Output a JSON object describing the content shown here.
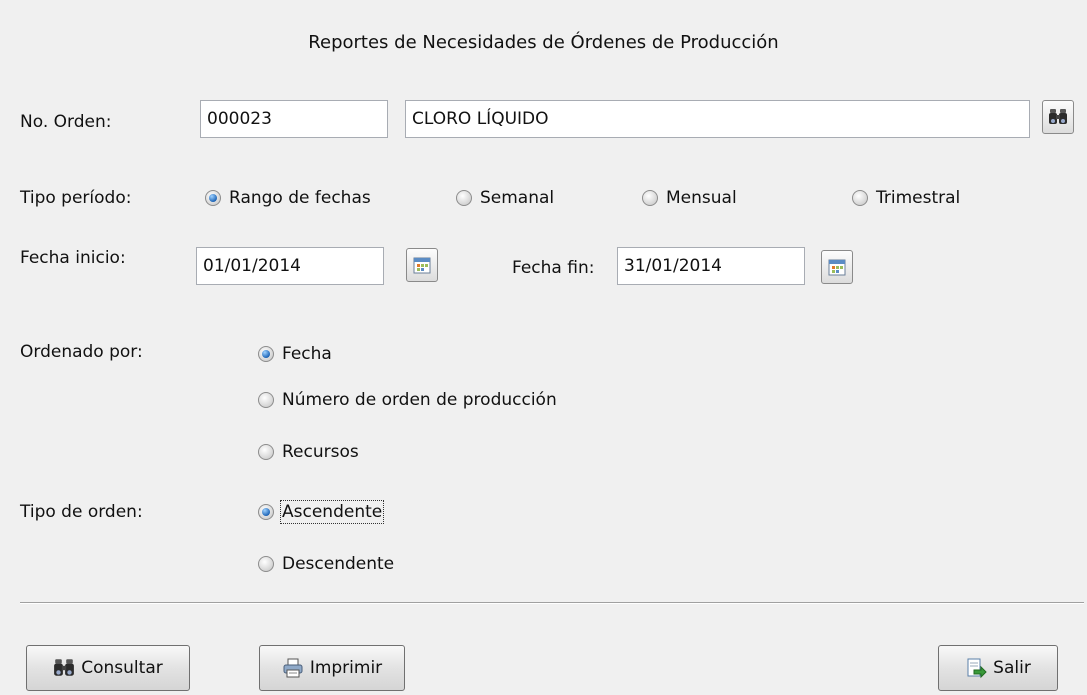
{
  "title": "Reportes de Necesidades de Órdenes de Producción",
  "orden": {
    "label": "No. Orden:",
    "number": "000023",
    "description": "CLORO LÍQUIDO"
  },
  "tipo_periodo": {
    "label": "Tipo período:",
    "options": [
      {
        "label": "Rango de fechas",
        "selected": true
      },
      {
        "label": "Semanal",
        "selected": false
      },
      {
        "label": "Mensual",
        "selected": false
      },
      {
        "label": "Trimestral",
        "selected": false
      }
    ]
  },
  "fechas": {
    "inicio_label": "Fecha inicio:",
    "inicio_value": "01/01/2014",
    "fin_label": "Fecha fin:",
    "fin_value": "31/01/2014"
  },
  "ordenado_por": {
    "label": "Ordenado por:",
    "options": [
      {
        "label": "Fecha",
        "selected": true
      },
      {
        "label": "Número de orden de producción",
        "selected": false
      },
      {
        "label": "Recursos",
        "selected": false
      }
    ]
  },
  "tipo_orden": {
    "label": "Tipo de orden:",
    "options": [
      {
        "label": "Ascendente",
        "selected": true
      },
      {
        "label": "Descendente",
        "selected": false
      }
    ]
  },
  "buttons": {
    "consultar": "Consultar",
    "imprimir": "Imprimir",
    "salir": "Salir"
  },
  "icons": {
    "search": "binoculars-icon",
    "calendar": "calendar-icon",
    "print": "printer-icon",
    "exit": "exit-icon"
  },
  "colors": {
    "background": "#f0f0f0",
    "radio_selected": "#1f66b8"
  }
}
